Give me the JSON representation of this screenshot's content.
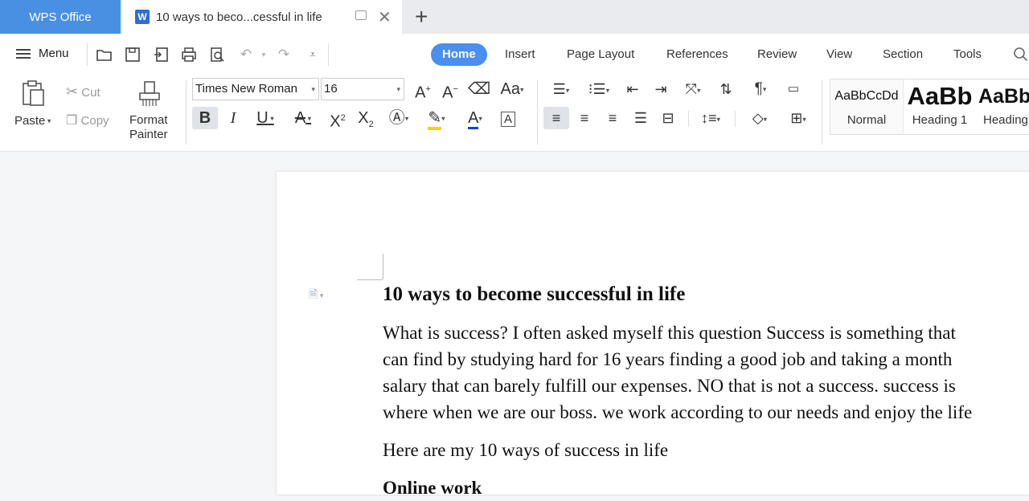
{
  "titlebar": {
    "app_tab": "WPS Office",
    "doc_tab": "10 ways to beco...cessful in life",
    "doc_icon": "W"
  },
  "menubar": {
    "menu_label": "Menu",
    "tabs": [
      "Home",
      "Insert",
      "Page Layout",
      "References",
      "Review",
      "View",
      "Section",
      "Tools"
    ],
    "active_tab": "Home"
  },
  "ribbon": {
    "paste": "Paste",
    "cut": "Cut",
    "copy": "Copy",
    "format_painter_line1": "Format",
    "format_painter_line2": "Painter",
    "font_name": "Times New Roman",
    "font_size": "16",
    "styles": [
      {
        "sample": "AaBbCcDd",
        "label": "Normal"
      },
      {
        "sample": "AaBb",
        "label": "Heading 1"
      },
      {
        "sample": "AaBb",
        "label": "Heading"
      }
    ]
  },
  "document": {
    "title": "10 ways to become successful in life",
    "para1_lines": [
      "What is success? I often asked myself this question Success is something that",
      "can find by studying hard for 16 years finding a good job and taking a month",
      "salary that can barely fulfill our expenses.  NO that is not a success. success is",
      "where when we are our boss. we work according to our needs and enjoy the life"
    ],
    "para2": "Here are my 10 ways of success in life",
    "heading2": "Online work"
  },
  "colors": {
    "accent": "#4a8ef0",
    "app_tab_bg": "#4a90e2"
  }
}
